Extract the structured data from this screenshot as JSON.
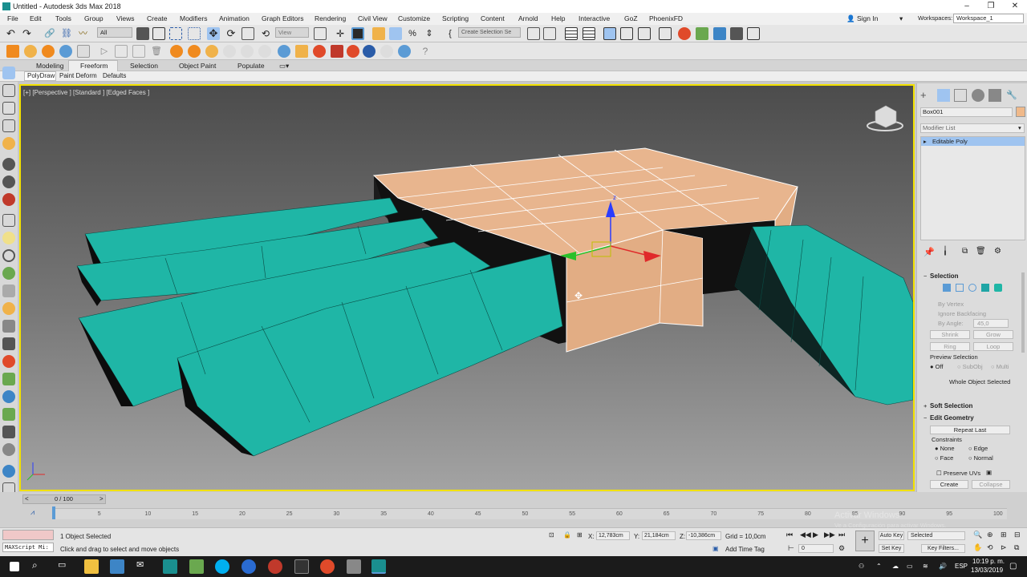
{
  "app": {
    "title": "Untitled - Autodesk 3ds Max 2018"
  },
  "window_controls": [
    "–",
    "❐",
    "✕"
  ],
  "menu": [
    "File",
    "Edit",
    "Tools",
    "Group",
    "Views",
    "Create",
    "Modifiers",
    "Animation",
    "Graph Editors",
    "Rendering",
    "Civil View",
    "Customize",
    "Scripting",
    "Content",
    "Arnold",
    "Help",
    "Interactive",
    "GoZ",
    "PhoenixFD"
  ],
  "account": {
    "sign_in": "Sign In",
    "workspaces_label": "Workspaces:",
    "workspace_value": "Workspace_1"
  },
  "toolbar": {
    "filter_value": "All",
    "coord_value": "View",
    "selection_set_placeholder": "Create Selection Se"
  },
  "ribbon": {
    "tabs": [
      "Modeling",
      "Freeform",
      "Selection",
      "Object Paint",
      "Populate"
    ],
    "active_tab": "Freeform",
    "subtabs": [
      "PolyDraw",
      "Paint Deform",
      "Defaults"
    ]
  },
  "viewport": {
    "label": "[+] [Perspective ] [Standard ] [Edged Faces ]"
  },
  "cmdpanel": {
    "object_name": "Box001",
    "object_color": "#f0b98a",
    "modifier_list_label": "Modifier List",
    "stack_item": "Editable Poly",
    "selection": {
      "title": "Selection",
      "by_vertex": "By Vertex",
      "ignore_backfacing": "Ignore Backfacing",
      "by_angle": "By Angle:",
      "angle_value": "45,0",
      "shrink": "Shrink",
      "grow": "Grow",
      "ring": "Ring",
      "loop": "Loop",
      "preview_selection": "Preview Selection",
      "preview_options": [
        "Off",
        "SubObj",
        "Multi"
      ],
      "status": "Whole Object Selected"
    },
    "soft_selection": {
      "title": "Soft Selection"
    },
    "edit_geometry": {
      "title": "Edit Geometry",
      "repeat_last": "Repeat Last",
      "constraints": "Constraints",
      "options": [
        "None",
        "Edge",
        "Face",
        "Normal"
      ],
      "preserve_uvs": "Preserve UVs",
      "create": "Create",
      "collapse": "Collapse"
    }
  },
  "timeline": {
    "frame_display": "0 / 100",
    "ticks": [
      "5",
      "10",
      "15",
      "20",
      "25",
      "30",
      "35",
      "40",
      "45",
      "50",
      "55",
      "60",
      "65",
      "70",
      "75",
      "80",
      "85",
      "90",
      "95",
      "100"
    ]
  },
  "status": {
    "maxscript": "MAXScript Mi:",
    "objects_selected": "1 Object Selected",
    "prompt": "Click and drag to select and move objects",
    "x_label": "X:",
    "x_value": "12,783cm",
    "y_label": "Y:",
    "y_value": "21,184cm",
    "z_label": "Z:",
    "z_value": "-10,386cm",
    "grid": "Grid = 10,0cm",
    "add_time_tag": "Add Time Tag",
    "auto_key": "Auto Key",
    "set_key": "Set Key",
    "selected": "Selected",
    "key_filters": "Key Filters...",
    "frame_field": "0",
    "watermark_1": "Activar Windows",
    "watermark_2": "Ve a Configuración para activar Windows."
  },
  "taskbar": {
    "lang": "ESP",
    "time": "10:19 p. m.",
    "date": "13/03/2019"
  },
  "colors": {
    "teal": "#1fb6a6",
    "box": "#e8b58e",
    "viewport_border": "#f2e100",
    "accent_blue": "#5b9bd5"
  }
}
